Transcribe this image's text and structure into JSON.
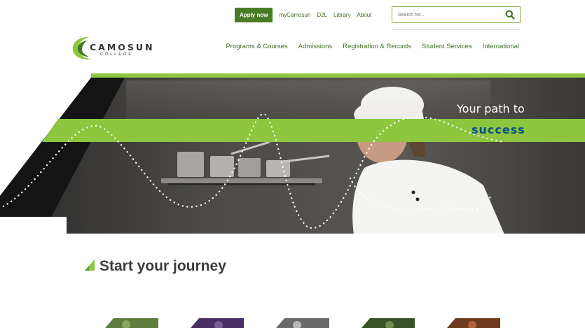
{
  "header": {
    "apply_label": "Apply now",
    "util_links": [
      "myCamosun",
      "D2L",
      "Library",
      "About"
    ],
    "search_placeholder": "Search for..."
  },
  "logo": {
    "name": "CAMOSUN",
    "sub": "COLLEGE"
  },
  "nav": {
    "items": [
      "Programs & Courses",
      "Admissions",
      "Registration & Records",
      "Student Services",
      "International"
    ]
  },
  "hero": {
    "tagline_line1": "Your path to",
    "tagline_line2": "success",
    "colors": {
      "brand_green": "#8dc63f",
      "brand_blue": "#0d4f8a",
      "dark": "#1b1b1b"
    }
  },
  "section": {
    "title": "Start your journey"
  },
  "thumbnails": {
    "count_visible": 5
  }
}
